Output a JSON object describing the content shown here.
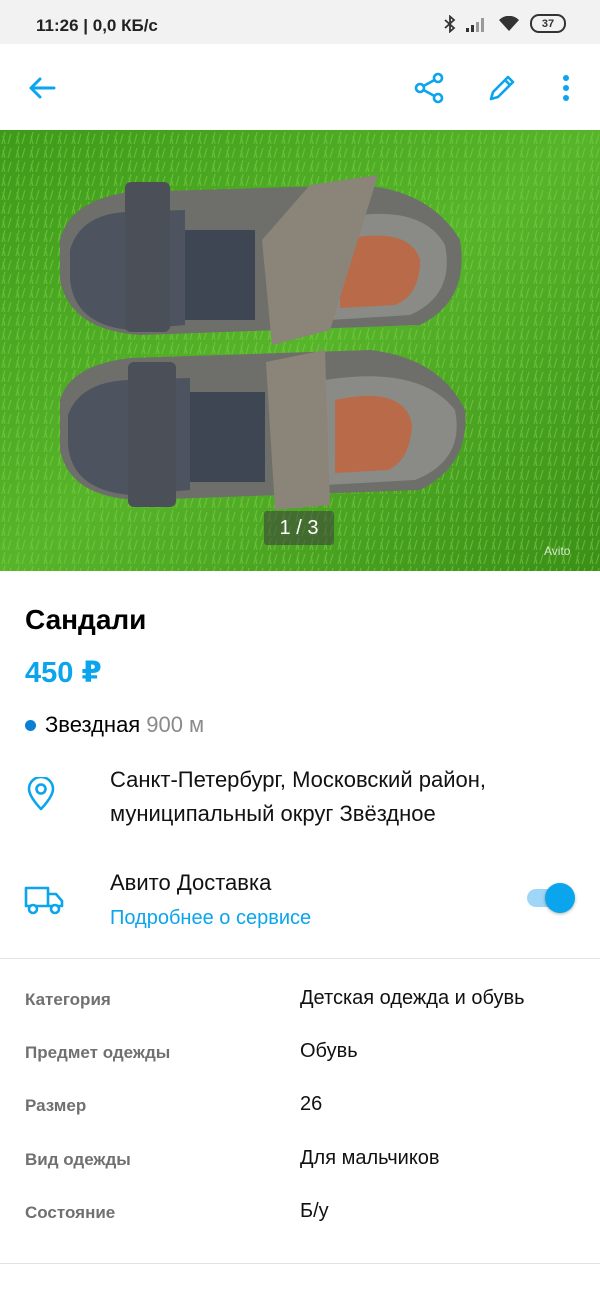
{
  "status": {
    "time": "11:26 | 0,0 КБ/с",
    "battery": "37"
  },
  "photo": {
    "counter": "1 / 3",
    "watermark": "Avito"
  },
  "listing": {
    "title": "Сандали",
    "price": "450 ₽"
  },
  "metro": {
    "station": "Звездная",
    "distance": "900 м",
    "color": "#0a7fd6"
  },
  "address": "Санкт-Петербург, Московский район, муниципальный округ Звёздное",
  "delivery": {
    "title": "Авито Доставка",
    "link": "Подробнее о сервисе",
    "enabled": true
  },
  "params": [
    {
      "label": "Категория",
      "value": "Детская одежда и обувь"
    },
    {
      "label": "Предмет одежды",
      "value": "Обувь"
    },
    {
      "label": "Размер",
      "value": "26"
    },
    {
      "label": "Вид одежды",
      "value": "Для мальчиков"
    },
    {
      "label": "Состояние",
      "value": "Б/у"
    }
  ],
  "colors": {
    "accent": "#0aa5ec"
  },
  "icons": [
    "back-arrow-icon",
    "share-icon",
    "edit-icon",
    "more-vert-icon",
    "location-pin-icon",
    "truck-icon",
    "bluetooth-icon",
    "signal-icon",
    "wifi-icon"
  ]
}
